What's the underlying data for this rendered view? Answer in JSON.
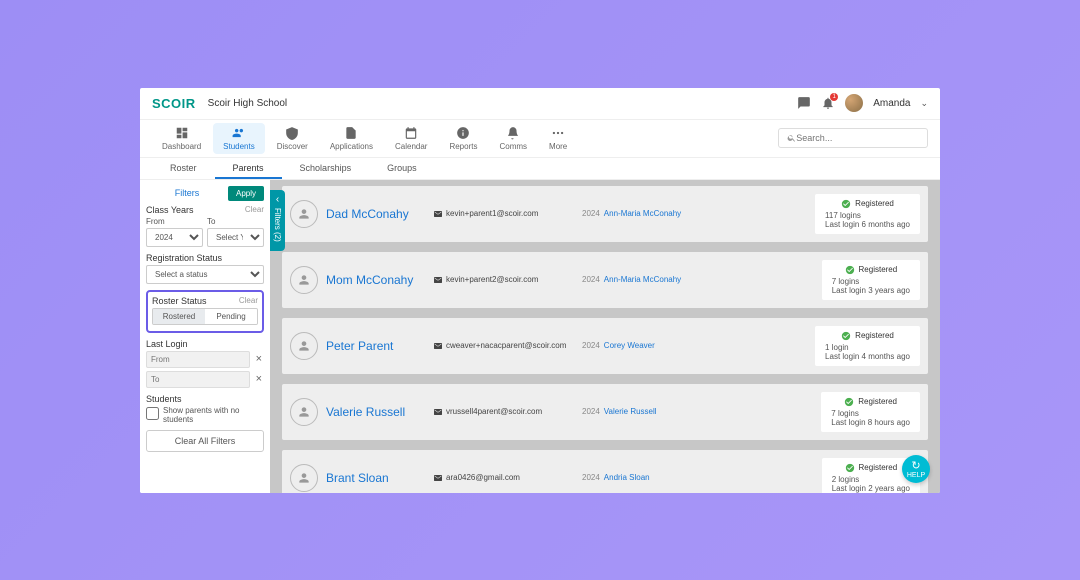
{
  "brand": "SCOIR",
  "school": "Scoir High School",
  "user": {
    "name": "Amanda",
    "notif_count": "1"
  },
  "search": {
    "placeholder": "Search..."
  },
  "mainnav": [
    {
      "label": "Dashboard"
    },
    {
      "label": "Students"
    },
    {
      "label": "Discover"
    },
    {
      "label": "Applications"
    },
    {
      "label": "Calendar"
    },
    {
      "label": "Reports"
    },
    {
      "label": "Comms"
    },
    {
      "label": "More"
    }
  ],
  "subnav": [
    {
      "label": "Roster"
    },
    {
      "label": "Parents"
    },
    {
      "label": "Scholarships"
    },
    {
      "label": "Groups"
    }
  ],
  "filters": {
    "title": "Filters",
    "apply": "Apply",
    "tab_label": "Filters (2)",
    "class_years": {
      "title": "Class Years",
      "clear": "Clear",
      "from_label": "From",
      "to_label": "To",
      "from_value": "2024",
      "to_value": "Select Year"
    },
    "registration": {
      "title": "Registration Status",
      "placeholder": "Select a status"
    },
    "roster_status": {
      "title": "Roster Status",
      "clear": "Clear",
      "rostered": "Rostered",
      "pending": "Pending"
    },
    "last_login": {
      "title": "Last Login",
      "from_placeholder": "From",
      "to_placeholder": "To"
    },
    "students": {
      "title": "Students",
      "checkbox_label": "Show parents with no students"
    },
    "clear_all": "Clear All Filters"
  },
  "status_label": "Registered",
  "parents": [
    {
      "name": "Dad McConahy",
      "email": "kevin+parent1@scoir.com",
      "year": "2024",
      "student": "Ann-Maria McConahy",
      "logins": "117 logins",
      "last": "Last login 6 months ago"
    },
    {
      "name": "Mom McConahy",
      "email": "kevin+parent2@scoir.com",
      "year": "2024",
      "student": "Ann-Maria McConahy",
      "logins": "7 logins",
      "last": "Last login 3 years ago"
    },
    {
      "name": "Peter Parent",
      "email": "cweaver+nacacparent@scoir.com",
      "year": "2024",
      "student": "Corey Weaver",
      "logins": "1 login",
      "last": "Last login 4 months ago"
    },
    {
      "name": "Valerie Russell",
      "email": "vrussell4parent@scoir.com",
      "year": "2024",
      "student": "Valerie Russell",
      "logins": "7 logins",
      "last": "Last login 8 hours ago"
    },
    {
      "name": "Brant Sloan",
      "email": "ara0426@gmail.com",
      "year": "2024",
      "student": "Andria Sloan",
      "logins": "2 logins",
      "last": "Last login 2 years ago"
    }
  ]
}
